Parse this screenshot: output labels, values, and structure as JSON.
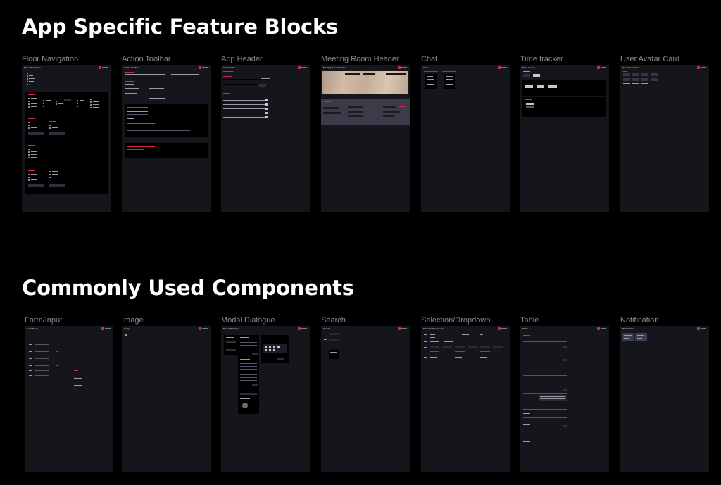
{
  "sections": {
    "app_specific": {
      "title": "App Specific Feature Blocks",
      "frames": [
        {
          "label": "Floor Navigation",
          "inner_title": "Floor Navigation"
        },
        {
          "label": "Action Toolbar",
          "inner_title": "Action Toolbar"
        },
        {
          "label": "App Header",
          "inner_title": "App Header"
        },
        {
          "label": "Meeting Room Header",
          "inner_title": "Meeting Room Header"
        },
        {
          "label": "Chat",
          "inner_title": "Chat"
        },
        {
          "label": "Time tracker",
          "inner_title": "Time tracker"
        },
        {
          "label": "User Avatar Card",
          "inner_title": "User Avatar Card"
        }
      ]
    },
    "common": {
      "title": "Commonly Used Components",
      "frames": [
        {
          "label": "Form/Input",
          "inner_title": "Form/Input"
        },
        {
          "label": "Image",
          "inner_title": "Image"
        },
        {
          "label": "Modal Dialogue",
          "inner_title": "Modal Dialogue"
        },
        {
          "label": "Search",
          "inner_title": "Search"
        },
        {
          "label": "Selection/Dropdown",
          "inner_title": "Selection/Dropdown"
        },
        {
          "label": "Table",
          "inner_title": "Table"
        },
        {
          "label": "Notification",
          "inner_title": "Notification"
        }
      ]
    }
  },
  "colors": {
    "canvas_background": "#000000",
    "frame_background": "#15151c",
    "frame_label": "#8a8a96",
    "accent": "#e0245e",
    "blue_button": "#3b5bd6"
  },
  "icons": {
    "brand_badge": "brand-logo-icon"
  }
}
